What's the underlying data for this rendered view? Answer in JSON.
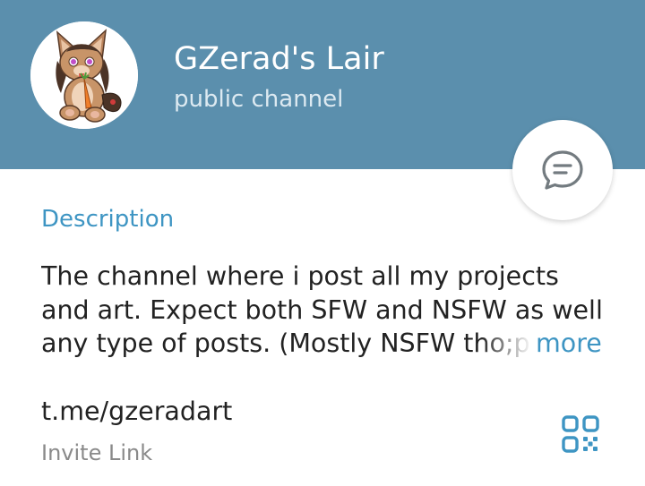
{
  "header": {
    "title": "GZerad's Lair",
    "subtitle": "public channel",
    "background_color": "#5b8fad",
    "avatar_icon": "channel-avatar-fox-character",
    "chat_button_icon": "chat-bubble-icon"
  },
  "description": {
    "label": "Description",
    "lines": [
      "The channel where i post all my projects",
      "and art. Expect both SFW and NSFW as well",
      "any type of posts. (Mostly NSFW tho;p"
    ],
    "more_label": "more"
  },
  "invite": {
    "link": "t.me/gzeradart",
    "caption": "Invite Link",
    "qr_icon": "qr-code-icon"
  },
  "colors": {
    "accent": "#3e95c3",
    "text": "#222222",
    "secondary_text": "#8a8a8a"
  }
}
